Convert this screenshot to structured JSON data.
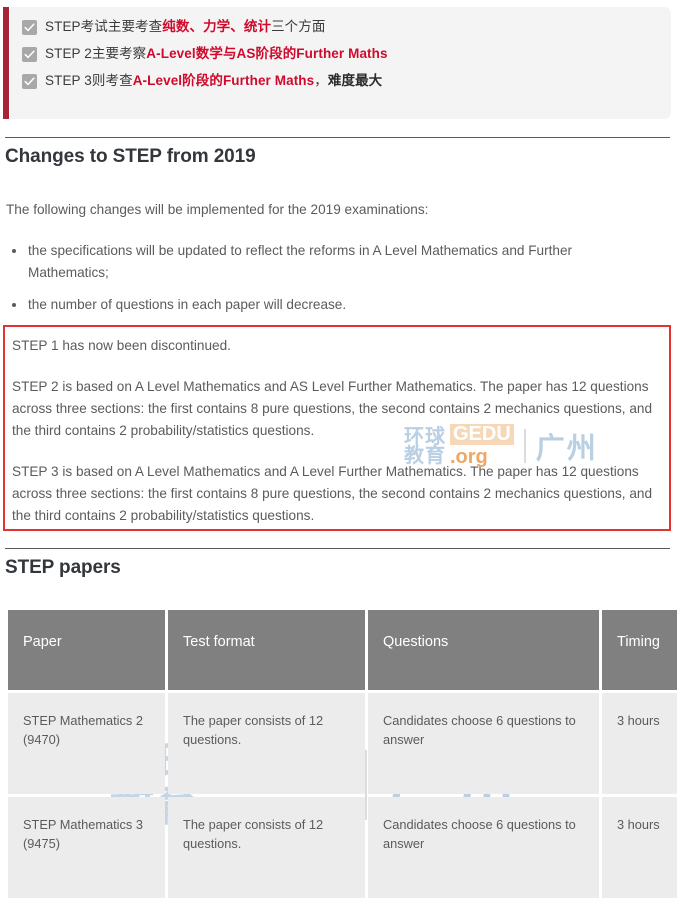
{
  "callout": {
    "accent_bar_color": "#a82437",
    "panel_color": "#f4f4f5",
    "items": [
      {
        "icon": "checkmark-icon",
        "parts": [
          {
            "text": "STEP考试主要考查",
            "style": "plain"
          },
          {
            "text": "纯数、力学、统计",
            "style": "red-bold"
          },
          {
            "text": "三个方面",
            "style": "plain"
          }
        ]
      },
      {
        "icon": "checkmark-icon",
        "parts": [
          {
            "text": "STEP 2主要考察",
            "style": "plain"
          },
          {
            "text": "A-Level数学与AS阶段的Further Maths",
            "style": "red-bold"
          }
        ]
      },
      {
        "icon": "checkmark-icon",
        "parts": [
          {
            "text": "STEP 3则考查",
            "style": "plain"
          },
          {
            "text": "A-Level阶段的Further Maths",
            "style": "red-bold"
          },
          {
            "text": "，",
            "style": "plain"
          },
          {
            "text": "难度最大",
            "style": "dark-bold"
          }
        ]
      }
    ]
  },
  "changes_section": {
    "heading": "Changes to STEP from 2019",
    "intro": "The following changes will be implemented for the 2019 examinations:",
    "bullets": [
      "the specifications will be updated to reflect the reforms in A Level Mathematics and Further Mathematics;",
      "the number of questions in each paper will decrease."
    ]
  },
  "highlight_box": {
    "border_color": "#e23232",
    "paragraphs": [
      "STEP 1 has now been discontinued.",
      "STEP 2 is based on A Level Mathematics and AS Level Further Mathematics. The paper has 12 questions across three sections: the first contains 8 pure questions, the second contains 2 mechanics questions, and the third contains 2 probability/statistics questions.",
      "STEP 3 is based on A Level Mathematics and A Level Further Mathematics. The paper has 12 questions across three sections: the first contains 8 pure questions, the second contains 2 mechanics questions, and the third contains 2 probability/statistics questions."
    ]
  },
  "papers_section": {
    "heading": "STEP papers",
    "table": {
      "header_bg": "#808080",
      "cell_bg": "#ececec",
      "columns": [
        "Paper",
        "Test format",
        "Questions",
        "Timing"
      ],
      "rows": [
        [
          "STEP Mathematics 2 (9470)",
          "The paper consists of 12 questions.",
          "Candidates choose 6 questions to answer",
          "3 hours"
        ],
        [
          "STEP Mathematics 3 (9475)",
          "The paper consists of 12 questions.",
          "Candidates choose 6 questions to answer",
          "3 hours"
        ]
      ]
    }
  },
  "watermark": {
    "line1": "环球",
    "line2": "教育",
    "brand": "GEDU",
    "domain": ".org",
    "city": "广州"
  }
}
